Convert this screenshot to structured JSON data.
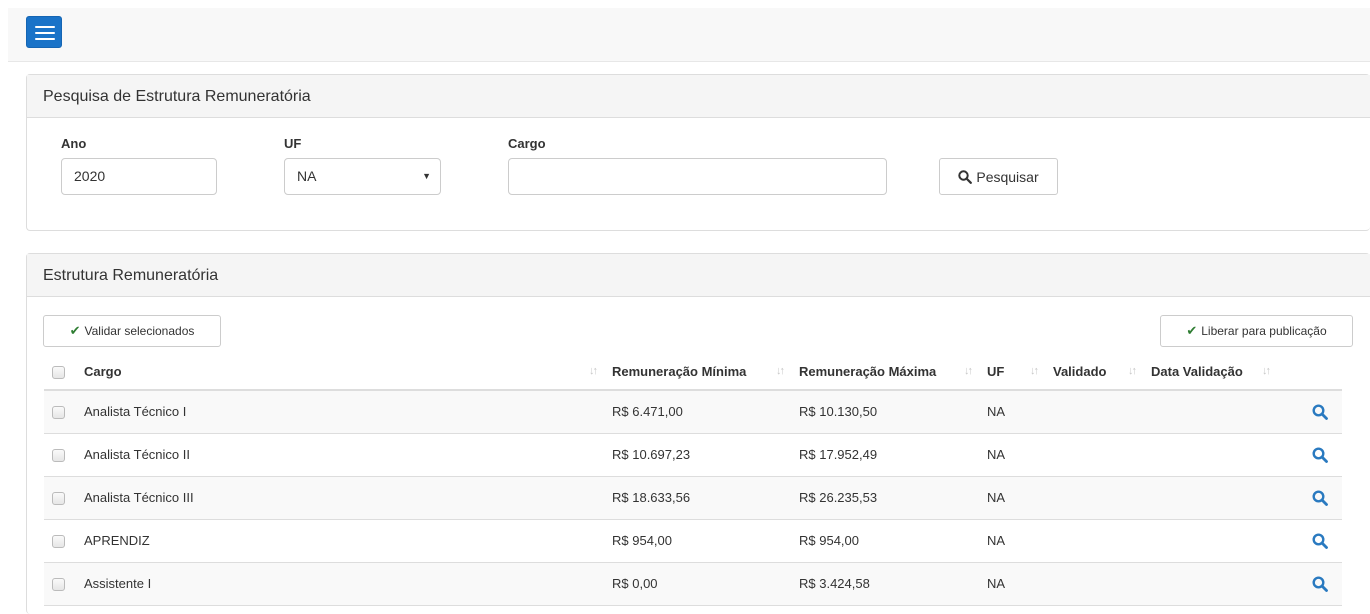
{
  "search_panel": {
    "title": "Pesquisa de Estrutura Remuneratória",
    "ano_label": "Ano",
    "ano_value": "2020",
    "uf_label": "UF",
    "uf_value": "NA",
    "cargo_label": "Cargo",
    "cargo_value": "",
    "search_button": "Pesquisar"
  },
  "results_panel": {
    "title": "Estrutura Remuneratória",
    "validate_button": "Validar selecionados",
    "publish_button": "Liberar para publicação",
    "columns": [
      "Cargo",
      "Remuneração Mínima",
      "Remuneração Máxima",
      "UF",
      "Validado",
      "Data Validação"
    ],
    "rows": [
      {
        "cargo": "Analista Técnico I",
        "min": "R$ 6.471,00",
        "max": "R$ 10.130,50",
        "uf": "NA",
        "validado": "",
        "data": ""
      },
      {
        "cargo": "Analista Técnico II",
        "min": "R$ 10.697,23",
        "max": "R$ 17.952,49",
        "uf": "NA",
        "validado": "",
        "data": ""
      },
      {
        "cargo": "Analista Técnico III",
        "min": "R$ 18.633,56",
        "max": "R$ 26.235,53",
        "uf": "NA",
        "validado": "",
        "data": ""
      },
      {
        "cargo": "APRENDIZ",
        "min": "R$ 954,00",
        "max": "R$ 954,00",
        "uf": "NA",
        "validado": "",
        "data": ""
      },
      {
        "cargo": "Assistente I",
        "min": "R$ 0,00",
        "max": "R$ 3.424,58",
        "uf": "NA",
        "validado": "",
        "data": ""
      }
    ]
  },
  "icons": {
    "menu": "hamburger-icon",
    "search": "search-icon",
    "check": "check-icon",
    "sort": "sort-icon",
    "view": "magnifier-icon"
  },
  "colors": {
    "primary": "#1a73c8",
    "check_green": "#2e7d32",
    "view_icon": "#2a7ac0"
  }
}
